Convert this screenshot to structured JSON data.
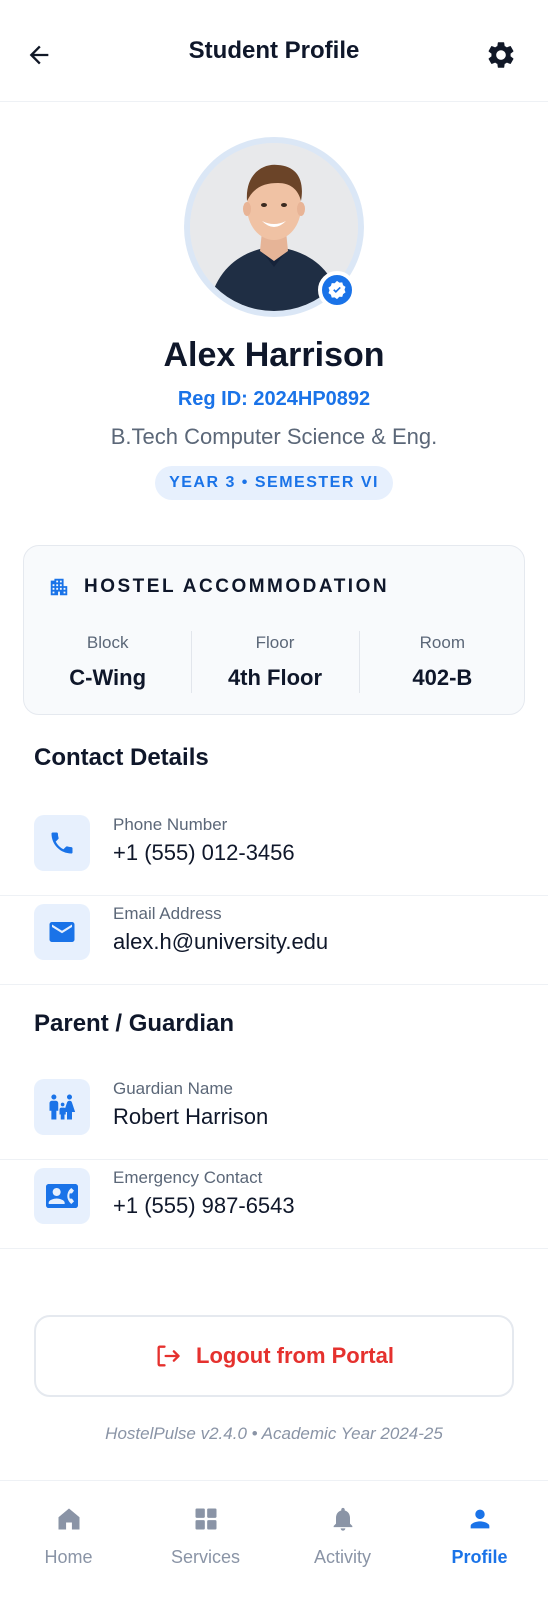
{
  "header": {
    "title": "Student Profile"
  },
  "profile": {
    "name": "Alex Harrison",
    "reg_id": "Reg ID: 2024HP0892",
    "program": "B.Tech Computer Science & Eng.",
    "year_badge": "YEAR 3 • SEMESTER VI"
  },
  "hostel": {
    "title": "HOSTEL ACCOMMODATION",
    "items": [
      {
        "label": "Block",
        "value": "C-Wing"
      },
      {
        "label": "Floor",
        "value": "4th Floor"
      },
      {
        "label": "Room",
        "value": "402-B"
      }
    ]
  },
  "contact": {
    "title": "Contact Details",
    "items": [
      {
        "label": "Phone Number",
        "value": "+1 (555) 012-3456",
        "icon": "phone-icon"
      },
      {
        "label": "Email Address",
        "value": "alex.h@university.edu",
        "icon": "email-icon"
      }
    ]
  },
  "guardian": {
    "title": "Parent / Guardian",
    "items": [
      {
        "label": "Guardian Name",
        "value": "Robert Harrison",
        "icon": "family-icon"
      },
      {
        "label": "Emergency Contact",
        "value": "+1 (555) 987-6543",
        "icon": "contact-phone-icon"
      }
    ]
  },
  "logout": {
    "label": "Logout from Portal"
  },
  "footer": {
    "note": "HostelPulse v2.4.0 • Academic Year 2024-25"
  },
  "nav": {
    "items": [
      {
        "label": "Home",
        "icon": "home-icon",
        "active": false
      },
      {
        "label": "Services",
        "icon": "grid-icon",
        "active": false
      },
      {
        "label": "Activity",
        "icon": "bell-icon",
        "active": false
      },
      {
        "label": "Profile",
        "icon": "person-icon",
        "active": true
      }
    ]
  },
  "colors": {
    "accent": "#1a73e8",
    "danger": "#e5312e",
    "muted": "#5b6778"
  }
}
